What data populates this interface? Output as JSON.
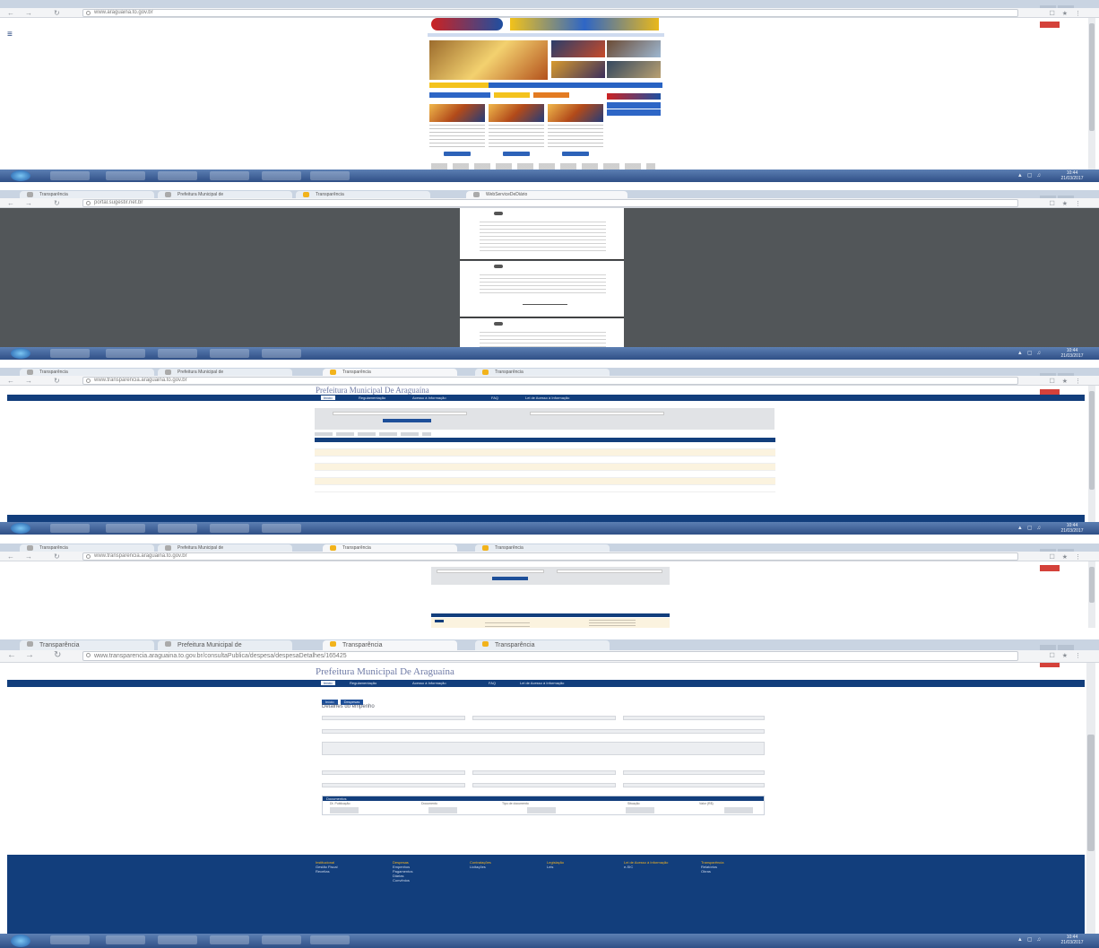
{
  "panel1": {
    "url": "www.araguaina.to.gov.br",
    "taskbar_apps": [
      "",
      "",
      "",
      "",
      "",
      ""
    ]
  },
  "panel2": {
    "tabs": [
      {
        "title": "Transparência"
      },
      {
        "title": "Prefeitura Municipal de"
      },
      {
        "title": "Transparência"
      },
      {
        "title": "WebServiceDeDiário"
      }
    ],
    "url": "portal.sugestir.net.br"
  },
  "panel3": {
    "tabs": [
      {
        "title": "Transparência"
      },
      {
        "title": "Prefeitura Municipal de"
      },
      {
        "title": "Transparência"
      },
      {
        "title": "Transparência"
      }
    ],
    "url": "www.transparencia.araguaina.to.gov.br",
    "site_title": "Prefeitura Municipal De Araguaína",
    "nav": [
      "Início",
      "Regulamentação",
      "Acesso à Informação",
      "FAQ",
      "Lei de Acesso à Informação"
    ]
  },
  "panel4": {
    "tabs": [
      {
        "title": "Transparência"
      },
      {
        "title": "Prefeitura Municipal de"
      },
      {
        "title": "Transparência"
      },
      {
        "title": "Transparência"
      }
    ],
    "url": "www.transparencia.araguaina.to.gov.br"
  },
  "panel5": {
    "tabs": [
      {
        "title": "Transparência"
      },
      {
        "title": "Prefeitura Municipal de"
      },
      {
        "title": "Transparência"
      },
      {
        "title": "Transparência"
      }
    ],
    "url": "www.transparencia.araguaina.to.gov.br/consultaPublica/despesa/despesaDetalhes/165425",
    "site_title": "Prefeitura Municipal De Araguaína",
    "nav": [
      "Início",
      "Regulamentação",
      "Acesso à Informação",
      "FAQ",
      "Lei de Acesso à Informação"
    ],
    "buttons": [
      "Início",
      "Despesas"
    ],
    "detail_title": "Detalhes do empenho",
    "docs_header": "Documentos",
    "docs_columns": [
      "Dt. Publicação",
      "Documento",
      "Tipo de documento",
      "Situação",
      "Valor (R$)"
    ],
    "footer": [
      {
        "heading": "Institucional",
        "items": [
          "Gestão Fiscal",
          "Receitas"
        ]
      },
      {
        "heading": "Despesas",
        "items": [
          "Empenhos",
          "Pagamentos",
          "Diárias",
          "Convênios"
        ]
      },
      {
        "heading": "Contratações",
        "items": [
          "Licitações"
        ]
      },
      {
        "heading": "Legislação",
        "items": [
          "Leis"
        ]
      },
      {
        "heading": "Lei de Acesso à Informação",
        "items": [
          "e-SIC"
        ]
      },
      {
        "heading": "Transparência",
        "items": [
          "Relatórios",
          "Obras"
        ]
      }
    ]
  },
  "taskbar": {
    "clock_time": "10:44",
    "clock_date": "21/03/2017"
  },
  "colors": {
    "brand_blue": "#123e7c",
    "accent_yellow": "#f3b31f",
    "taskbar": "#2f4f86",
    "pdf_background": "#525659"
  }
}
